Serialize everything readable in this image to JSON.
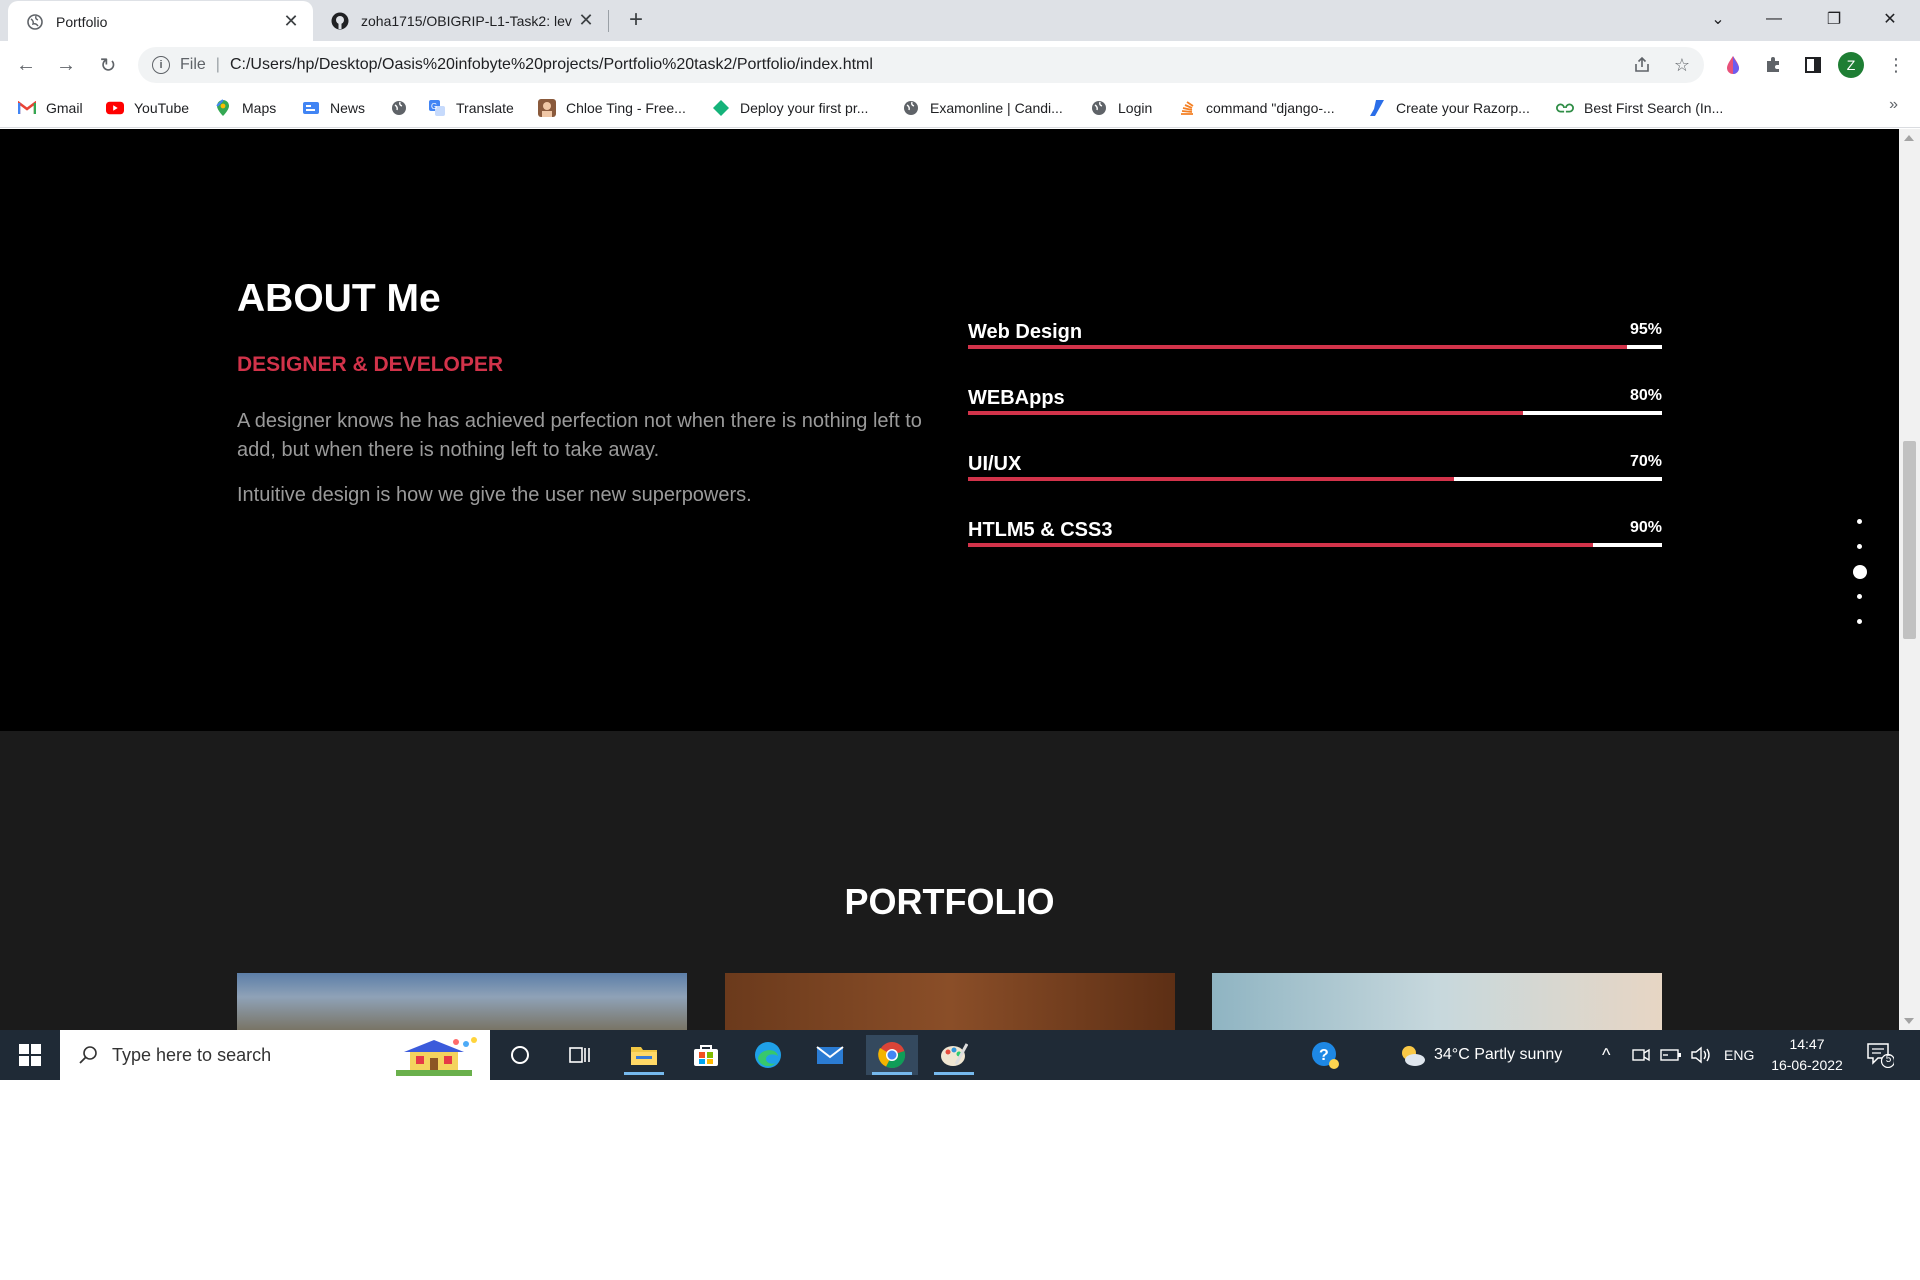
{
  "browser": {
    "tabs": [
      {
        "title": "Portfolio",
        "active": true
      },
      {
        "title": "zoha1715/OBIGRIP-L1-Task2: lev",
        "active": false
      }
    ],
    "omnibox": {
      "scheme": "File",
      "url": "C:/Users/hp/Desktop/Oasis%20infobyte%20projects/Portfolio%20task2/Portfolio/index.html"
    },
    "profile_initial": "Z",
    "bookmarks": [
      {
        "label": "Gmail",
        "icon": "gmail-icon"
      },
      {
        "label": "YouTube",
        "icon": "youtube-icon"
      },
      {
        "label": "Maps",
        "icon": "maps-icon"
      },
      {
        "label": "News",
        "icon": "news-icon"
      },
      {
        "label": "",
        "icon": "globe-icon"
      },
      {
        "label": "Translate",
        "icon": "translate-icon"
      },
      {
        "label": "Chloe Ting - Free...",
        "icon": "avatar-icon"
      },
      {
        "label": "Deploy your first pr...",
        "icon": "diamond-icon"
      },
      {
        "label": "Examonline | Candi...",
        "icon": "globe-icon"
      },
      {
        "label": "Login",
        "icon": "globe-icon"
      },
      {
        "label": "command \"django-...",
        "icon": "stack-icon"
      },
      {
        "label": "Create your Razorp...",
        "icon": "razorpay-icon"
      },
      {
        "label": "Best First Search (In...",
        "icon": "gfg-icon"
      }
    ],
    "more_bookmarks": "»"
  },
  "page": {
    "about": {
      "title": "ABOUT Me",
      "subtitle": "DESIGNER & DEVELOPER",
      "paragraph1": "A designer knows he has achieved perfection not when there is nothing left to add, but when there is nothing left to take away.",
      "paragraph2": "Intuitive design is how we give the user new superpowers.",
      "skills": [
        {
          "name": "Web Design",
          "percent_label": "95%",
          "level": 0.95
        },
        {
          "name": "WEBApps",
          "percent_label": "80%",
          "level": 0.8
        },
        {
          "name": "UI/UX",
          "percent_label": "70%",
          "level": 0.7
        },
        {
          "name": "HTLM5 & CSS3",
          "percent_label": "90%",
          "level": 0.9
        }
      ],
      "nav_dots": {
        "count": 5,
        "active_index": 2
      }
    },
    "portfolio": {
      "title": "PORTFOLIO"
    },
    "colors": {
      "accent": "#d2334a",
      "about_bg": "#000000",
      "portfolio_bg": "#1b1b1b"
    }
  },
  "taskbar": {
    "search_placeholder": "Type here to search",
    "weather": "34°C  Partly sunny",
    "language": "ENG",
    "time": "14:47",
    "date": "16-06-2022",
    "notification_count": "5"
  }
}
